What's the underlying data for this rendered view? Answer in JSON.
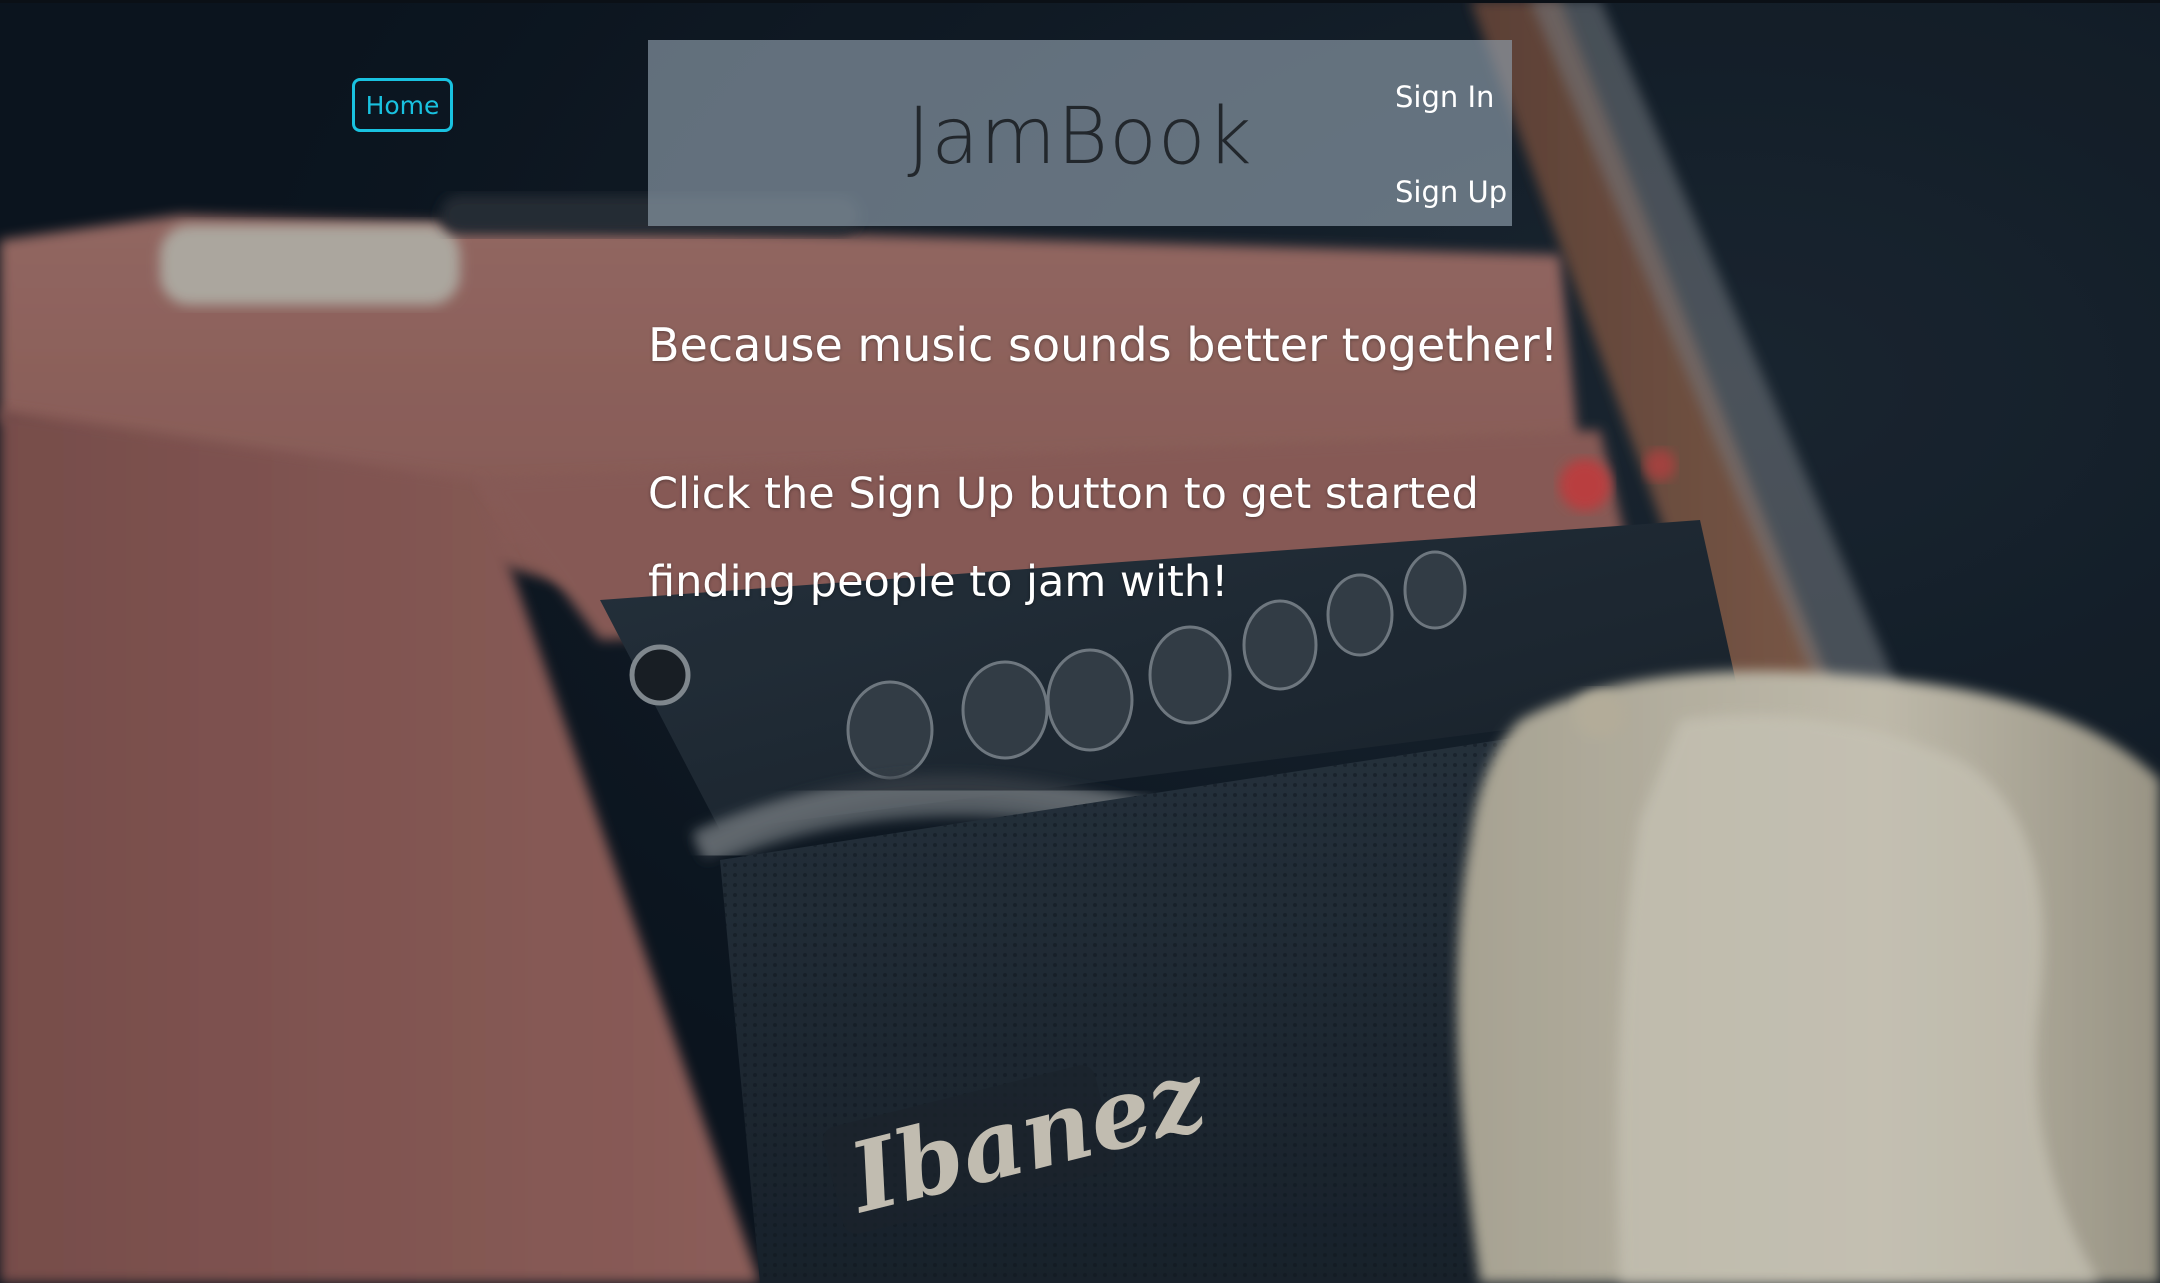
{
  "nav": {
    "home_label": "Home",
    "sign_in_label": "Sign In",
    "sign_up_label": "Sign Up"
  },
  "header": {
    "brand": "JamBook"
  },
  "main": {
    "tagline": "Because music sounds better together!",
    "cta_line1": "Click the Sign Up button to get started",
    "cta_line2": "finding people to jam with!"
  },
  "background": {
    "description_icon": "guitar-amplifier-photo-background",
    "amp_brand_text": "Ibanez"
  },
  "colors": {
    "accent": "#19c2e0",
    "header_overlay": "#8e9eac",
    "brand_text": "#22272c"
  }
}
